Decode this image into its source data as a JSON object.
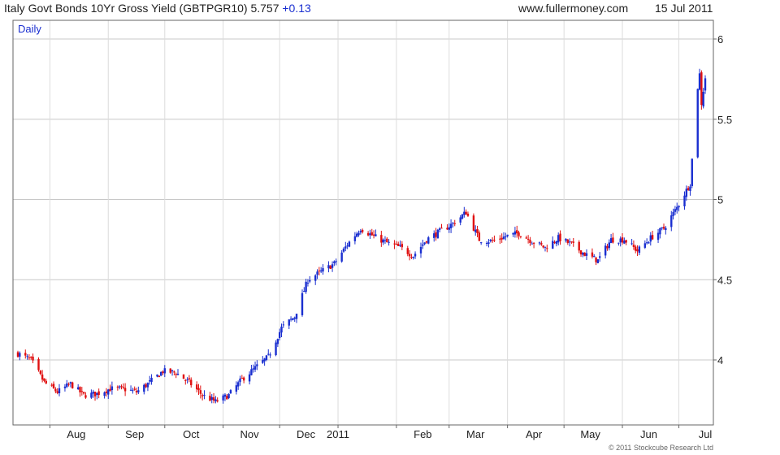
{
  "header": {
    "title": "Italy Govt Bonds 10Yr Gross Yield (GBTPGR10) 5.757",
    "change": "+0.13",
    "site": "www.fullermoney.com",
    "date": "15 Jul 2011"
  },
  "period_label": "Daily",
  "copyright": "© 2011 Stockcube Research Ltd",
  "chart_data": {
    "type": "candlestick",
    "y_ticks": [
      "6",
      "5.5",
      "5",
      "4.5",
      "4"
    ],
    "x_ticks": [
      "Aug",
      "Sep",
      "Oct",
      "Nov",
      "Dec",
      "2011",
      "Feb",
      "Mar",
      "Apr",
      "May",
      "Jun",
      "Jul"
    ],
    "ylim": [
      3.6,
      6.05
    ],
    "grid": true,
    "up_color": "#1a2fd0",
    "down_color": "#e01010",
    "close_points": [
      [
        "2010-07-15",
        4.04
      ],
      [
        "2010-07-22",
        4.0
      ],
      [
        "2010-07-29",
        3.86
      ],
      [
        "2010-08-05",
        3.8
      ],
      [
        "2010-08-12",
        3.85
      ],
      [
        "2010-08-19",
        3.78
      ],
      [
        "2010-08-26",
        3.79
      ],
      [
        "2010-09-02",
        3.82
      ],
      [
        "2010-09-09",
        3.82
      ],
      [
        "2010-09-16",
        3.8
      ],
      [
        "2010-09-23",
        3.86
      ],
      [
        "2010-09-30",
        3.93
      ],
      [
        "2010-10-07",
        3.92
      ],
      [
        "2010-10-14",
        3.86
      ],
      [
        "2010-10-21",
        3.78
      ],
      [
        "2010-10-28",
        3.74
      ],
      [
        "2010-11-04",
        3.78
      ],
      [
        "2010-11-11",
        3.88
      ],
      [
        "2010-11-18",
        3.95
      ],
      [
        "2010-11-25",
        4.02
      ],
      [
        "2010-12-02",
        4.2
      ],
      [
        "2010-12-09",
        4.27
      ],
      [
        "2010-12-16",
        4.5
      ],
      [
        "2010-12-23",
        4.55
      ],
      [
        "2010-12-30",
        4.6
      ],
      [
        "2011-01-06",
        4.72
      ],
      [
        "2011-01-13",
        4.82
      ],
      [
        "2011-01-20",
        4.77
      ],
      [
        "2011-01-27",
        4.73
      ],
      [
        "2011-02-03",
        4.7
      ],
      [
        "2011-02-10",
        4.65
      ],
      [
        "2011-02-17",
        4.75
      ],
      [
        "2011-02-24",
        4.8
      ],
      [
        "2011-03-03",
        4.85
      ],
      [
        "2011-03-10",
        4.92
      ],
      [
        "2011-03-17",
        4.75
      ],
      [
        "2011-03-24",
        4.74
      ],
      [
        "2011-03-31",
        4.77
      ],
      [
        "2011-04-07",
        4.79
      ],
      [
        "2011-04-14",
        4.74
      ],
      [
        "2011-04-21",
        4.7
      ],
      [
        "2011-04-28",
        4.76
      ],
      [
        "2011-05-05",
        4.72
      ],
      [
        "2011-05-12",
        4.66
      ],
      [
        "2011-05-19",
        4.62
      ],
      [
        "2011-05-26",
        4.75
      ],
      [
        "2011-06-02",
        4.75
      ],
      [
        "2011-06-09",
        4.68
      ],
      [
        "2011-06-16",
        4.76
      ],
      [
        "2011-06-23",
        4.82
      ],
      [
        "2011-06-30",
        4.95
      ],
      [
        "2011-07-07",
        5.1
      ],
      [
        "2011-07-11",
        5.7
      ],
      [
        "2011-07-12",
        5.78
      ],
      [
        "2011-07-13",
        5.6
      ],
      [
        "2011-07-15",
        5.76
      ]
    ]
  }
}
